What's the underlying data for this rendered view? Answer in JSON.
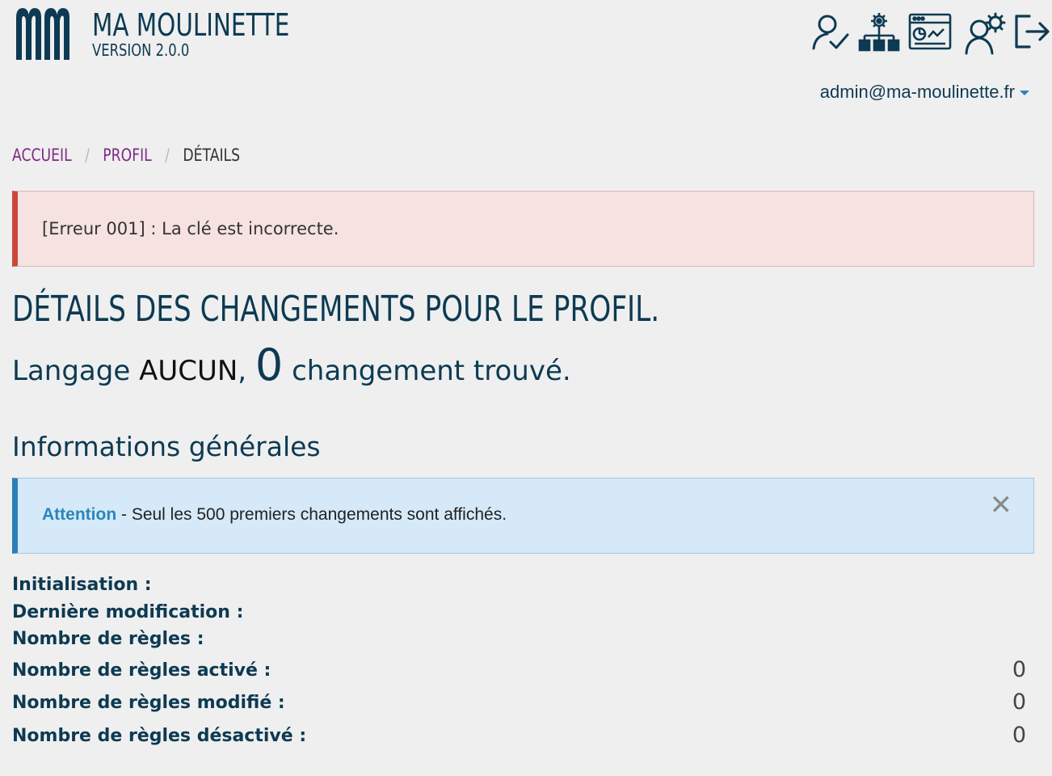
{
  "header": {
    "app_title": "MA MOULINETTE",
    "version": "VERSION 2.0.0",
    "logo_icon": "mm-logo-icon",
    "tools": [
      {
        "name": "user-check-icon"
      },
      {
        "name": "sitemap-gear-icon"
      },
      {
        "name": "dashboard-window-icon"
      },
      {
        "name": "users-settings-icon"
      },
      {
        "name": "logout-icon"
      }
    ],
    "user_email": "admin@ma-moulinette.fr",
    "accent_color": "#0d3a52"
  },
  "breadcrumb": {
    "home": "ACCUEIL",
    "profile": "PROFIL",
    "current": "DÉTAILS",
    "separator": "/"
  },
  "error_alert": {
    "text": "[Erreur 001] : La clé est incorrecte.",
    "color": "#c9473b"
  },
  "page": {
    "heading": "DÉTAILS DES CHANGEMENTS POUR LE PROFIL.",
    "summary_prefix": "Langage",
    "language": "AUCUN",
    "summary_comma": ",",
    "change_count": "0",
    "summary_suffix": "changement trouvé."
  },
  "general_info": {
    "title": "Informations générales",
    "notice_strong": "Attention",
    "notice_text": " - Seul les 500 premiers changements sont affichés.",
    "close_icon": "close-icon",
    "rows": [
      {
        "label": "Initialisation :",
        "value": ""
      },
      {
        "label": "Dernière modification :",
        "value": ""
      },
      {
        "label": "Nombre de règles :",
        "value": ""
      },
      {
        "label": "Nombre de règles activé :",
        "value": "0"
      },
      {
        "label": "Nombre de règles modifié :",
        "value": "0"
      },
      {
        "label": "Nombre de règles désactivé :",
        "value": "0"
      }
    ]
  }
}
